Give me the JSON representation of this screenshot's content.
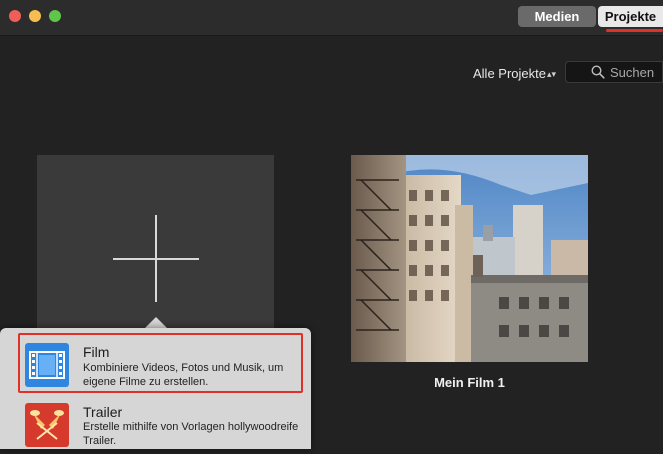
{
  "window": {
    "controls": [
      "close",
      "minimize",
      "zoom"
    ]
  },
  "segmented": {
    "medien": "Medien",
    "projekte": "Projekte",
    "selected": "Projekte"
  },
  "toolbar": {
    "filter_label": "Alle Projekte",
    "filter_icon": "up-down-chevron-icon",
    "search_placeholder": "Suchen",
    "search_icon": "magnifier-icon"
  },
  "projects": [
    {
      "title": "Mein Film 1",
      "thumbnail": "city-buildings-photo"
    }
  ],
  "new_project": {
    "icon": "plus-icon",
    "menu": [
      {
        "title": "Film",
        "description": "Kombiniere Videos, Fotos und Musik, um eigene Filme zu erstellen.",
        "icon": "film-strip-icon",
        "highlighted": true
      },
      {
        "title": "Trailer",
        "description": "Erstelle mithilfe von Vorlagen hollywoodreife Trailer.",
        "icon": "spotlight-icon",
        "highlighted": false
      }
    ]
  },
  "colors": {
    "accent_red": "#e0302a",
    "film_blue": "#2e86e0",
    "trailer_red": "#d63a2c"
  }
}
